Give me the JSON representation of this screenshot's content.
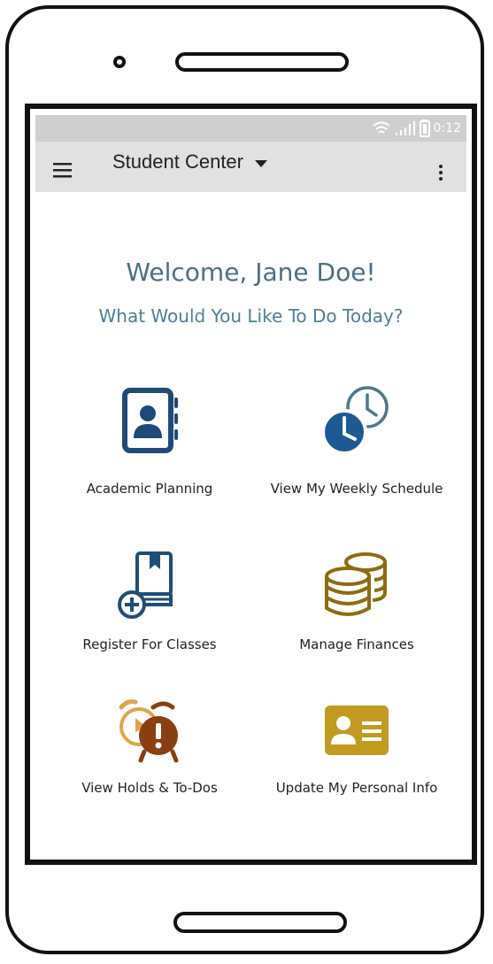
{
  "status_bar": {
    "time": "0:12",
    "icons": [
      "wifi-icon",
      "signal-icon",
      "battery-icon"
    ]
  },
  "app_bar": {
    "title": "Student Center",
    "icons": [
      "hamburger-menu-icon",
      "dropdown-arrow-icon",
      "more-vertical-icon"
    ]
  },
  "main": {
    "welcome": "Welcome, Jane Doe!",
    "prompt": "What Would You Like To Do Today?"
  },
  "tiles": [
    {
      "label": "Academic Planning",
      "icon": "address-book-icon",
      "color": "#1d4a78"
    },
    {
      "label": "View My Weekly Schedule",
      "icon": "clocks-icon",
      "color": "#1d5a94"
    },
    {
      "label": "Register For Classes",
      "icon": "book-add-icon",
      "color": "#1f4e78"
    },
    {
      "label": "Manage Finances",
      "icon": "coin-stack-icon",
      "color": "#8c6c0e"
    },
    {
      "label": "View Holds & To-Dos",
      "icon": "alarm-alert-icon",
      "color": "#8a3f10"
    },
    {
      "label": "Update My Personal Info",
      "icon": "id-card-icon",
      "color": "#c29a20"
    }
  ],
  "colors": {
    "status_bar": "#cfcfcf",
    "app_bar": "#e1e1e1",
    "heading": "#4d6f84"
  }
}
